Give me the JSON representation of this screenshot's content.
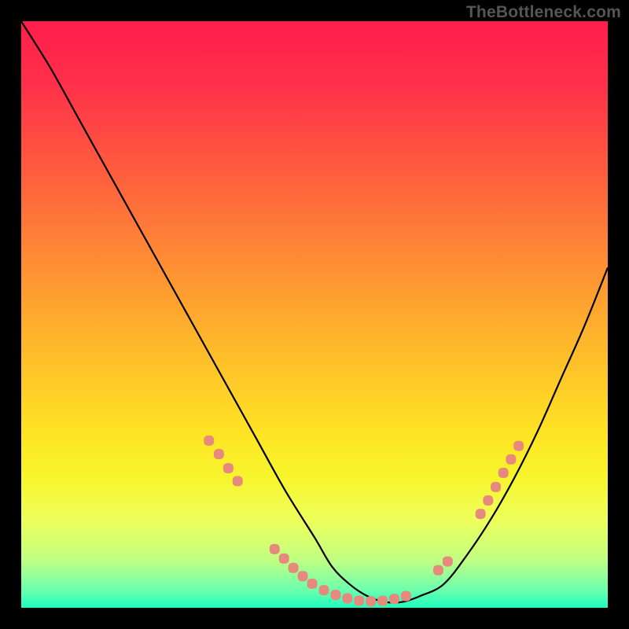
{
  "watermark": "TheBottleneck.com",
  "chart_data": {
    "type": "line",
    "title": "",
    "xlabel": "",
    "ylabel": "",
    "xlim": [
      0,
      100
    ],
    "ylim": [
      0,
      100
    ],
    "series": [
      {
        "name": "bottleneck-curve",
        "x": [
          0,
          5,
          10,
          15,
          20,
          25,
          30,
          35,
          40,
          45,
          50,
          53,
          56,
          59,
          62,
          65,
          68,
          72,
          76,
          80,
          84,
          88,
          92,
          96,
          100
        ],
        "y": [
          100,
          92,
          83,
          74,
          65,
          56,
          47,
          38,
          29,
          20,
          12,
          7,
          4,
          2,
          1,
          1,
          2,
          4,
          9,
          15,
          22,
          30,
          39,
          48,
          58
        ]
      }
    ],
    "highlight_points": {
      "name": "salmon-dots",
      "color": "#E78A7E",
      "points": [
        {
          "x": 32.0,
          "y": 28.5
        },
        {
          "x": 33.7,
          "y": 26.2
        },
        {
          "x": 35.3,
          "y": 23.8
        },
        {
          "x": 36.9,
          "y": 21.6
        },
        {
          "x": 43.2,
          "y": 10.0
        },
        {
          "x": 44.8,
          "y": 8.4
        },
        {
          "x": 46.4,
          "y": 6.8
        },
        {
          "x": 48.0,
          "y": 5.4
        },
        {
          "x": 49.6,
          "y": 4.1
        },
        {
          "x": 51.6,
          "y": 3.0
        },
        {
          "x": 53.6,
          "y": 2.2
        },
        {
          "x": 55.6,
          "y": 1.6
        },
        {
          "x": 57.6,
          "y": 1.2
        },
        {
          "x": 59.6,
          "y": 1.1
        },
        {
          "x": 61.6,
          "y": 1.2
        },
        {
          "x": 63.6,
          "y": 1.5
        },
        {
          "x": 65.6,
          "y": 2.0
        },
        {
          "x": 71.1,
          "y": 6.4
        },
        {
          "x": 72.7,
          "y": 7.9
        },
        {
          "x": 78.3,
          "y": 16.0
        },
        {
          "x": 79.6,
          "y": 18.3
        },
        {
          "x": 80.9,
          "y": 20.6
        },
        {
          "x": 82.2,
          "y": 23.0
        },
        {
          "x": 83.5,
          "y": 25.3
        },
        {
          "x": 84.8,
          "y": 27.6
        }
      ]
    }
  }
}
